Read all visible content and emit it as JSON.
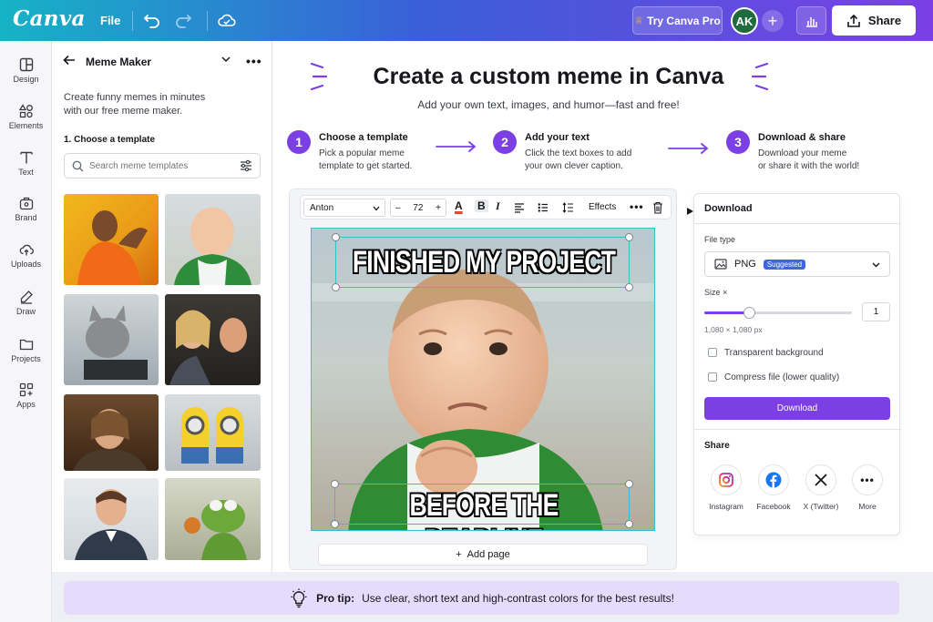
{
  "app": {
    "logo": "Canva"
  },
  "topbar": {
    "file_label": "File",
    "pro_label": "Try Canva Pro",
    "avatar_initials": "AK",
    "share_label": "Share"
  },
  "rail": {
    "items": [
      {
        "label": "Design",
        "icon": "layout-icon"
      },
      {
        "label": "Elements",
        "icon": "shapes-icon"
      },
      {
        "label": "Text",
        "icon": "text-icon"
      },
      {
        "label": "Brand",
        "icon": "briefcase-icon"
      },
      {
        "label": "Uploads",
        "icon": "upload-cloud-icon"
      },
      {
        "label": "Draw",
        "icon": "pen-icon"
      },
      {
        "label": "Projects",
        "icon": "folder-icon"
      },
      {
        "label": "Apps",
        "icon": "apps-grid-icon"
      }
    ]
  },
  "panel": {
    "title": "Meme Maker",
    "description_line1": "Create funny memes in minutes",
    "description_line2": "with our free meme maker.",
    "step_label": "1. Choose a template",
    "search_placeholder": "Search meme templates"
  },
  "hero": {
    "title": "Create a custom meme in Canva",
    "subtitle": "Add your own text, images, and humor—fast and free!"
  },
  "steps": [
    {
      "num": "1",
      "title": "Choose a template",
      "line1": "Pick a popular meme",
      "line2": "template to get started."
    },
    {
      "num": "2",
      "title": "Add your text",
      "line1": "Click the text boxes to add",
      "line2": "your own clever caption."
    },
    {
      "num": "3",
      "title": "Download & share",
      "line1": "Download your meme",
      "line2": "or share it with the world!"
    }
  ],
  "toolbar": {
    "font": "Anton",
    "font_size": "72",
    "minus": "–",
    "plus": "+",
    "color_glyph": "A",
    "bold_glyph": "B",
    "italic_glyph": "I",
    "effects_label": "Effects"
  },
  "meme": {
    "top_text": "FINISHED MY PROJECT",
    "bottom_text": "BEFORE THE DEADLINE"
  },
  "editor": {
    "add_page_label": "Add page"
  },
  "download": {
    "title": "Download",
    "file_type_label": "File type",
    "file_type_value": "PNG",
    "suggested_badge": "Suggested",
    "size_label": "Size ×",
    "size_value": "1",
    "size_fraction": 0.3,
    "dimensions": "1,080 × 1,080 px",
    "transparent_label": "Transparent background",
    "compress_label": "Compress file (lower quality)",
    "button_label": "Download",
    "share_title": "Share",
    "share_items": [
      {
        "label": "Instagram",
        "icon": "instagram-icon"
      },
      {
        "label": "Facebook",
        "icon": "facebook-icon"
      },
      {
        "label": "X (Twitter)",
        "icon": "x-twitter-icon"
      },
      {
        "label": "More",
        "icon": "more-dots-icon"
      }
    ]
  },
  "tip": {
    "label": "Pro tip:",
    "text": "Use clear, short text and high-contrast colors for the best results!"
  },
  "colors": {
    "accent": "#7b3fe4",
    "selection": "#2ec4cf",
    "badge": "#3f66e2"
  }
}
